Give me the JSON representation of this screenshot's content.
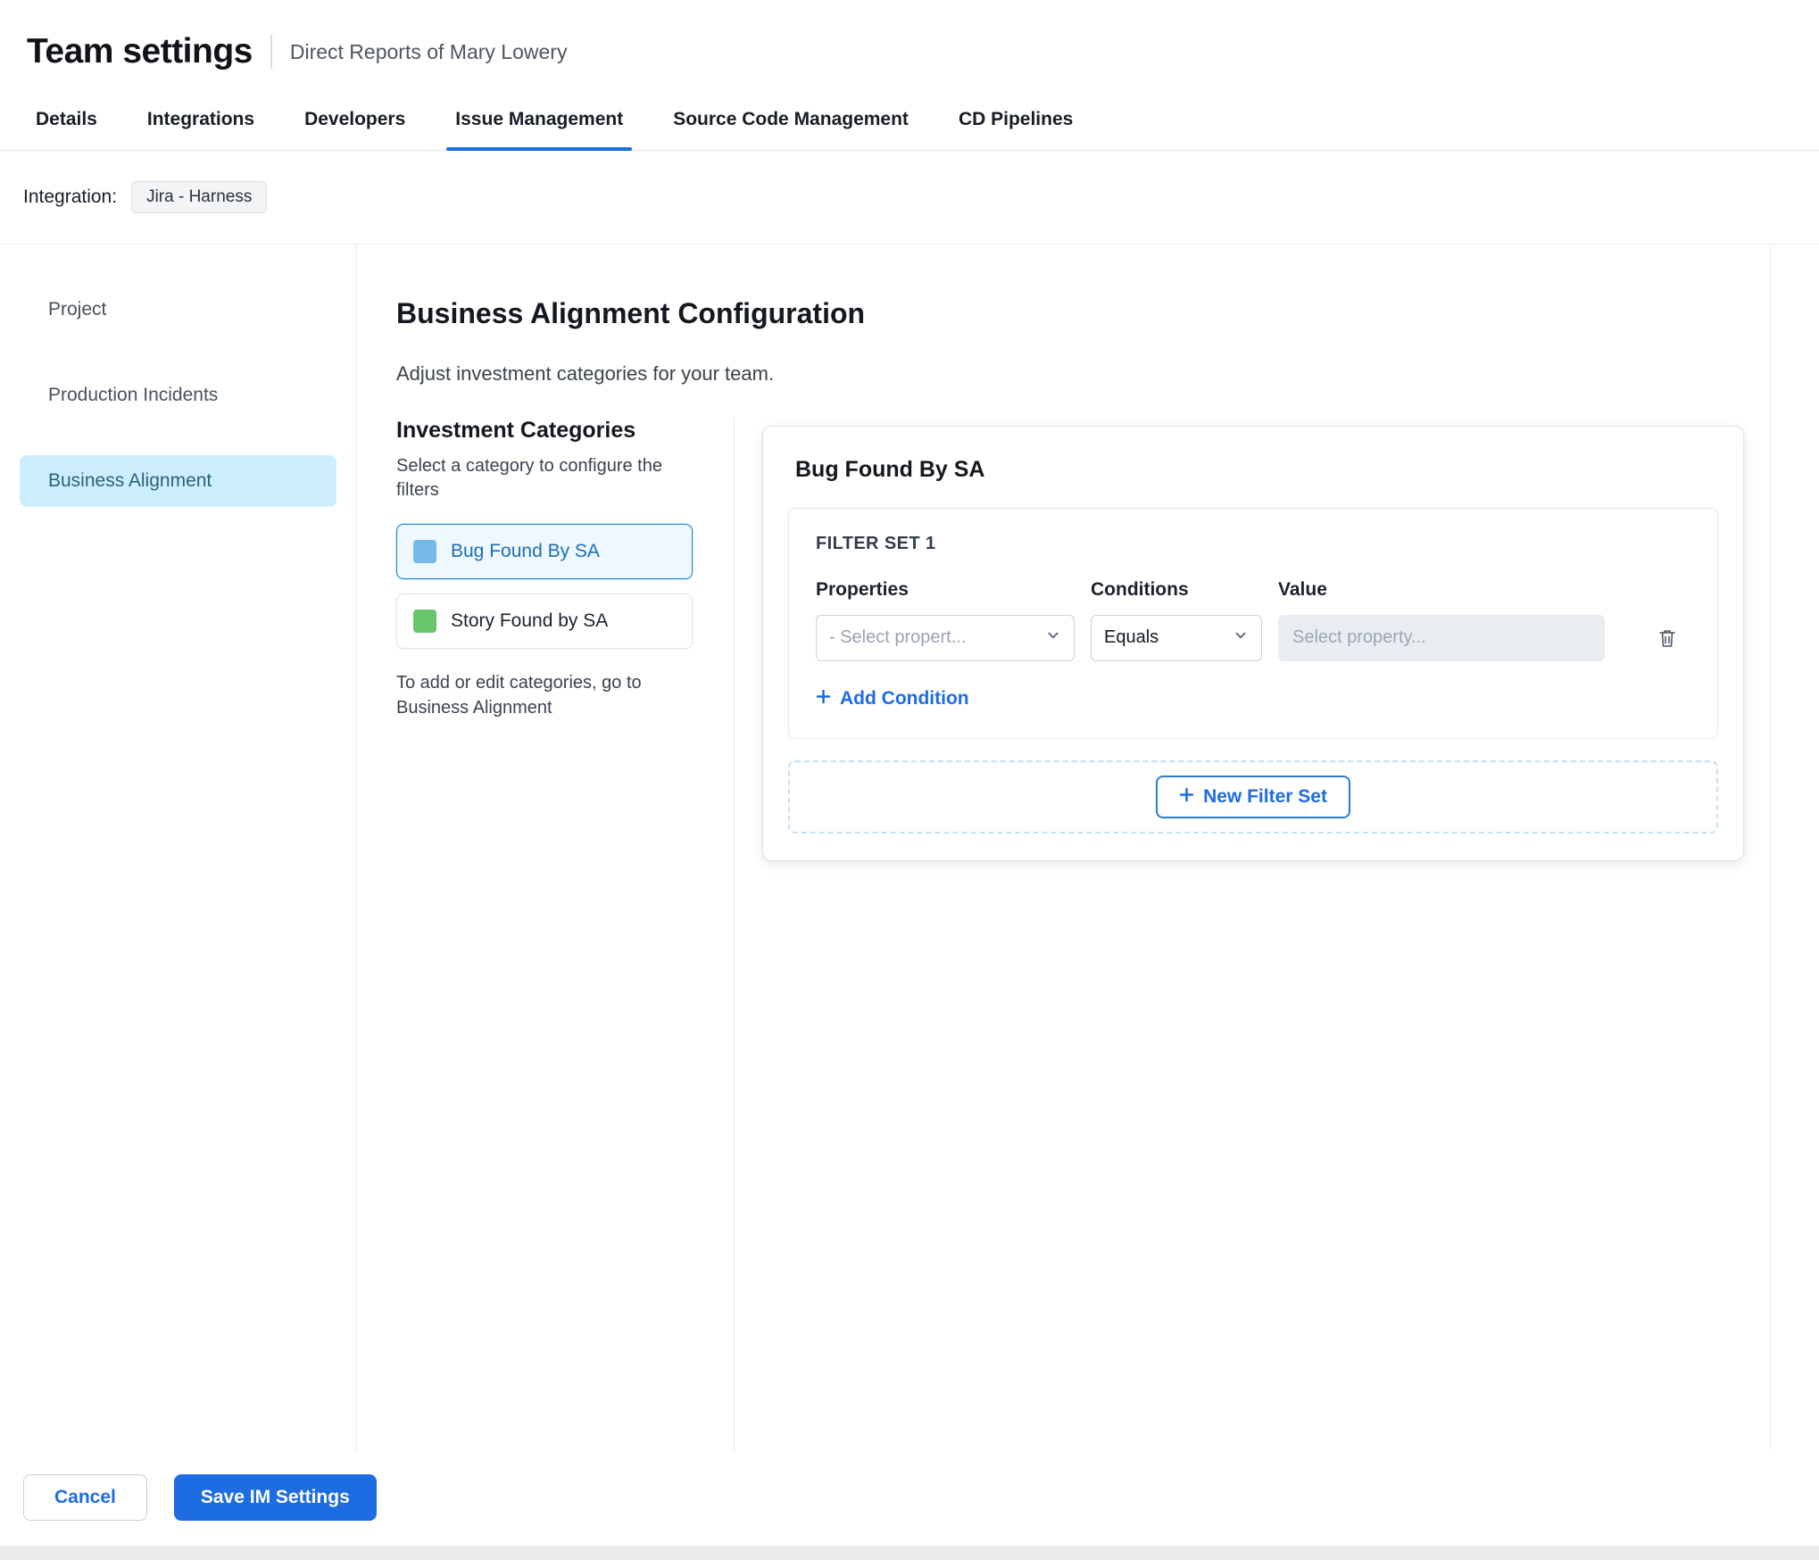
{
  "colors": {
    "accent": "#1d6ce2",
    "sidebar_selected_bg": "#cdeffd",
    "category_selected_bg": "#eef8fe",
    "category_selected_border": "#1b85d4",
    "bug_swatch": "#74b9e8",
    "story_swatch": "#68c468"
  },
  "header": {
    "title": "Team settings",
    "subtitle": "Direct Reports of Mary Lowery"
  },
  "tabs": [
    {
      "label": "Details"
    },
    {
      "label": "Integrations"
    },
    {
      "label": "Developers"
    },
    {
      "label": "Issue Management"
    },
    {
      "label": "Source Code Management"
    },
    {
      "label": "CD Pipelines"
    }
  ],
  "integration": {
    "label": "Integration:",
    "value": "Jira - Harness"
  },
  "sidebar": {
    "items": [
      {
        "label": "Project"
      },
      {
        "label": "Production Incidents"
      },
      {
        "label": "Business Alignment"
      }
    ]
  },
  "main": {
    "title": "Business Alignment Configuration",
    "subtitle": "Adjust investment categories for your team.",
    "categories": {
      "heading": "Investment Categories",
      "instruction": "Select a category to configure the filters",
      "items": [
        {
          "label": "Bug Found By SA",
          "swatch": "#74b9e8"
        },
        {
          "label": "Story Found by SA",
          "swatch": "#68c468"
        }
      ],
      "footnote": "To add or edit categories, go to Business Alignment"
    },
    "card": {
      "title": "Bug Found By SA",
      "filter_set": {
        "title": "FILTER SET 1",
        "columns": {
          "properties": "Properties",
          "conditions": "Conditions",
          "value": "Value"
        },
        "property_placeholder": "- Select propert...",
        "condition_value": "Equals",
        "value_placeholder": "Select property...",
        "add_condition_label": "Add Condition"
      },
      "new_filter_set_label": "New Filter Set"
    }
  },
  "footer": {
    "cancel_label": "Cancel",
    "save_label": "Save IM Settings"
  }
}
